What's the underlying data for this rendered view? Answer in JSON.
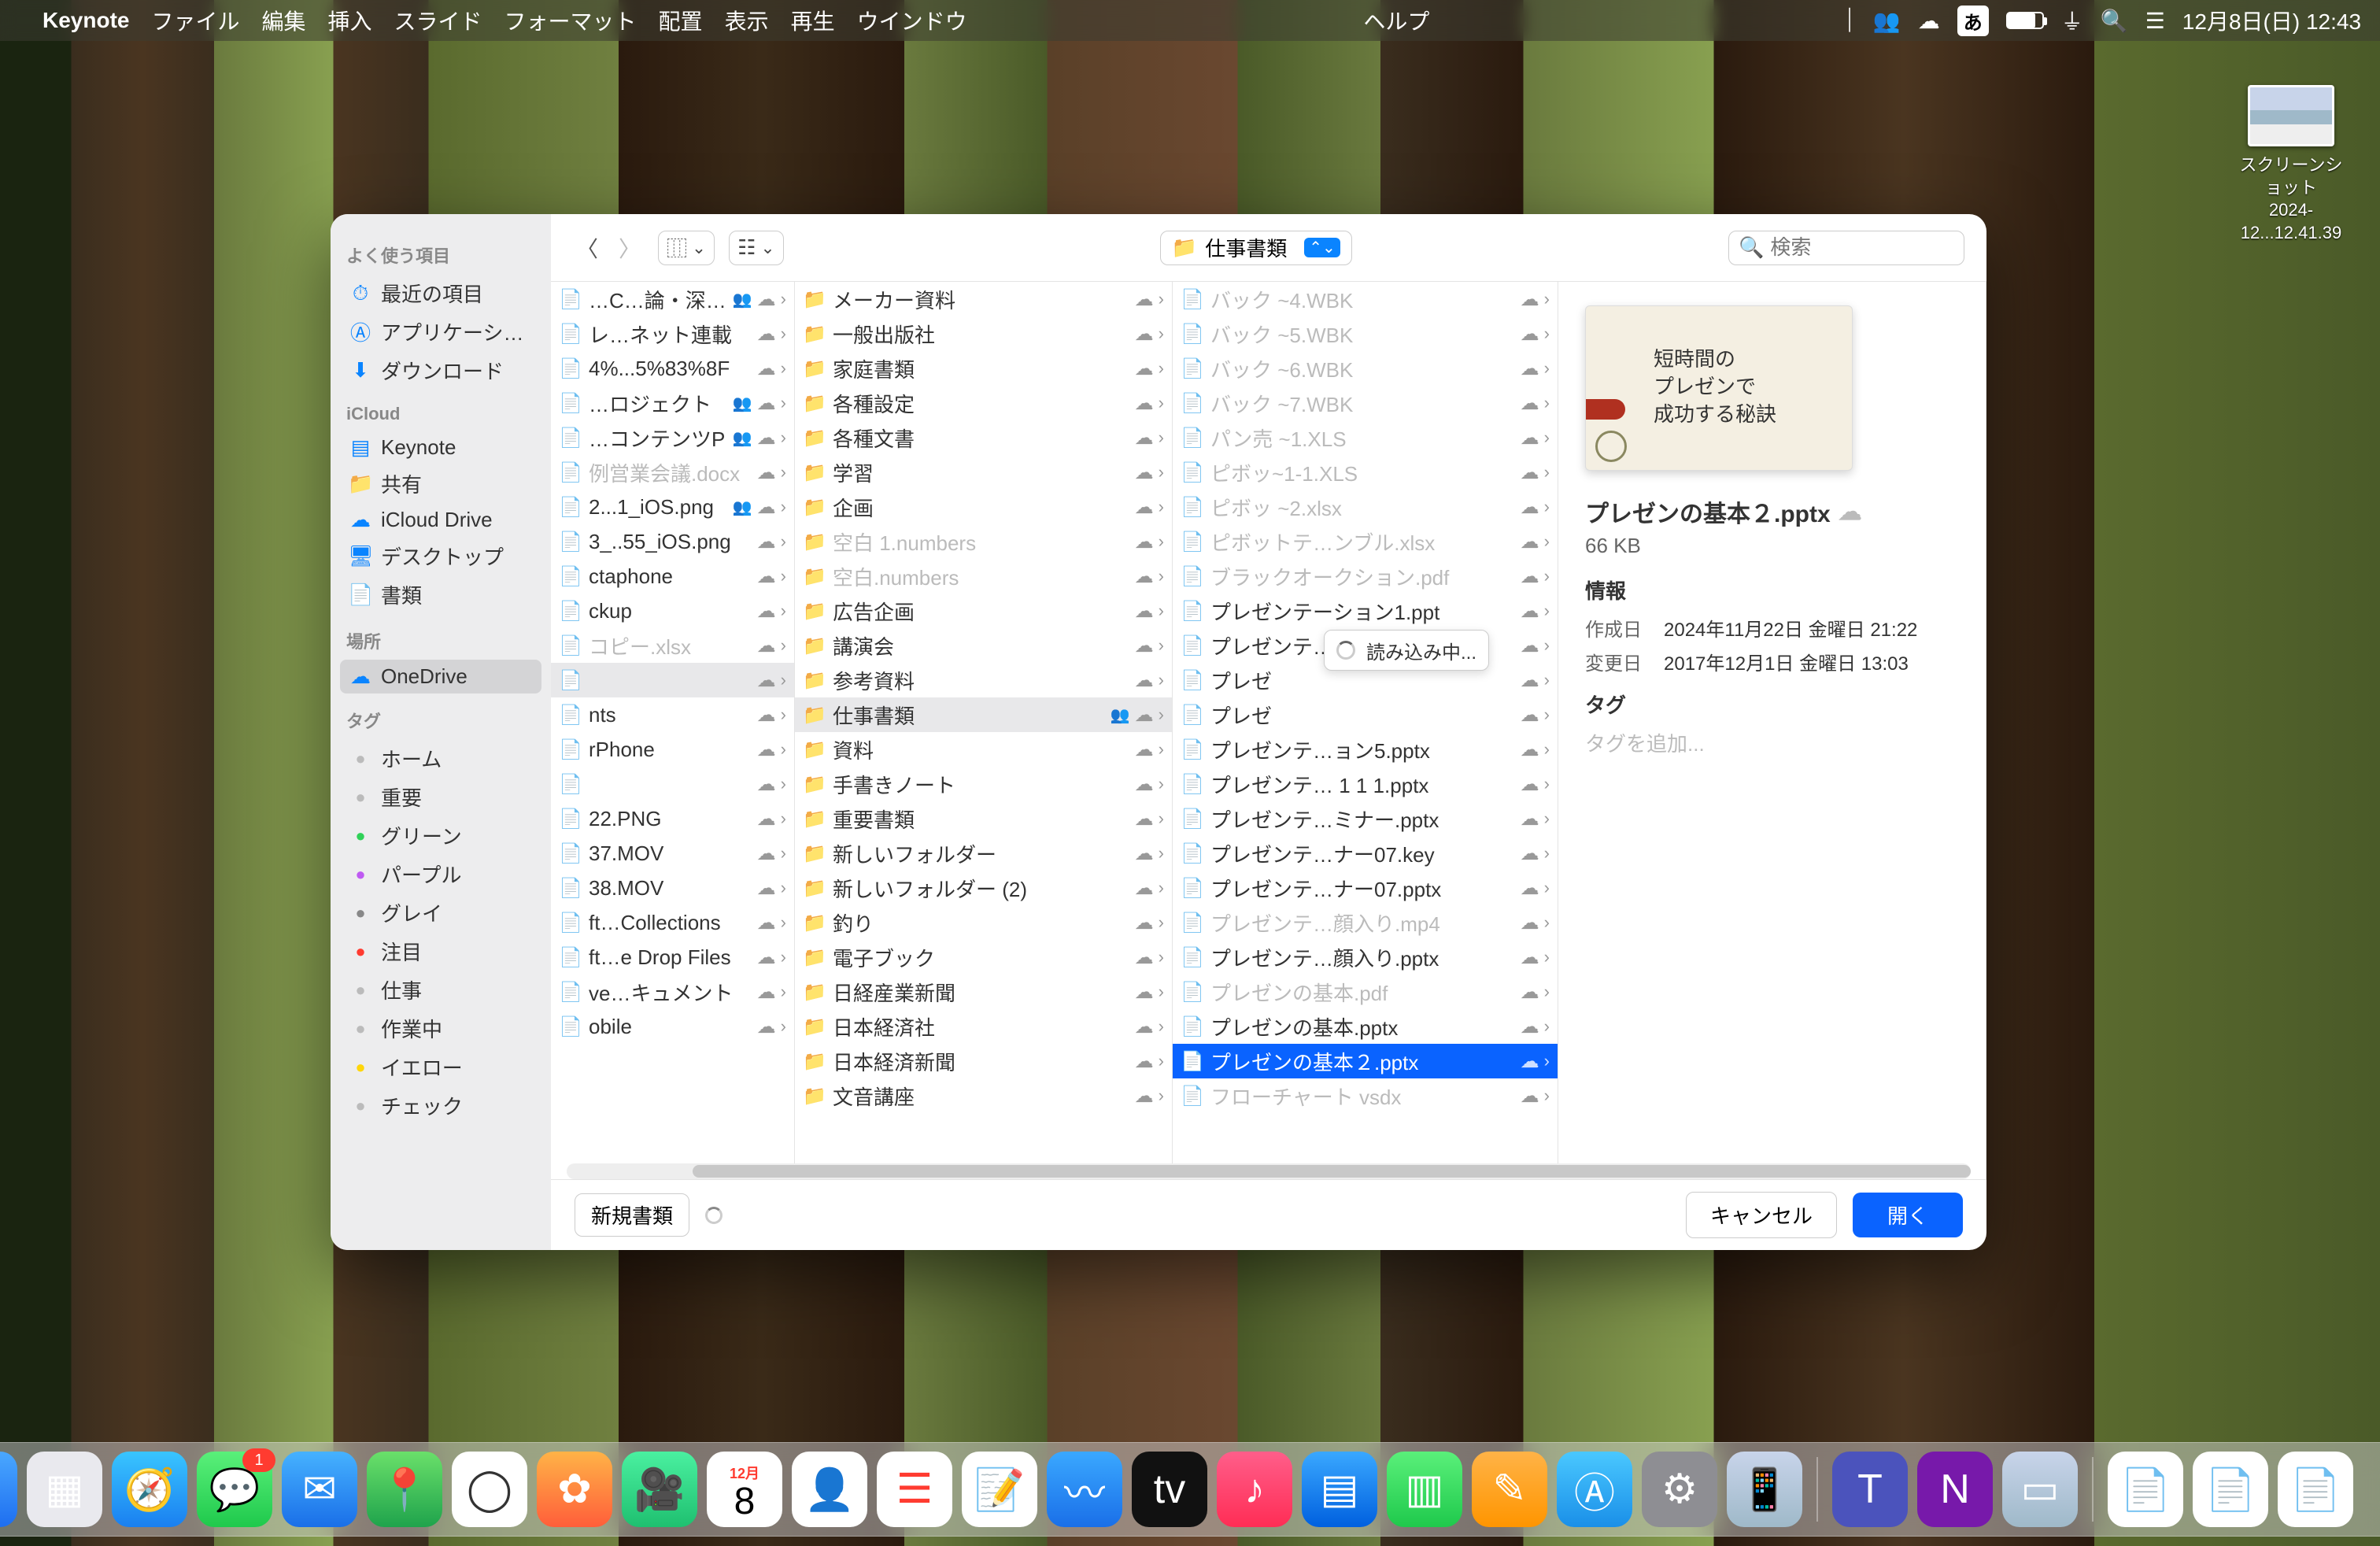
{
  "menubar": {
    "app": "Keynote",
    "items": [
      "ファイル",
      "編集",
      "挿入",
      "スライド",
      "フォーマット",
      "配置",
      "表示",
      "再生",
      "ウインドウ"
    ],
    "help": "ヘルプ",
    "ime": "あ",
    "datetime": "12月8日(日)  12:43"
  },
  "desktop_icon": {
    "line1": "スクリーンショット",
    "line2": "2024-12...12.41.39"
  },
  "dialog": {
    "path_label": "仕事書類",
    "search_placeholder": "検索",
    "loading": "読み込み中...",
    "new_doc": "新規書類",
    "cancel": "キャンセル",
    "open": "開く"
  },
  "sidebar": {
    "sec1": "よく使う項目",
    "items1": [
      {
        "icon": "⏱",
        "label": "最近の項目"
      },
      {
        "icon": "Ⓐ",
        "label": "アプリケーシ…"
      },
      {
        "icon": "⬇",
        "label": "ダウンロード"
      }
    ],
    "sec2": "iCloud",
    "items2": [
      {
        "icon": "▤",
        "label": "Keynote"
      },
      {
        "icon": "📁",
        "label": "共有"
      },
      {
        "icon": "☁",
        "label": "iCloud Drive"
      },
      {
        "icon": "🖥",
        "label": "デスクトップ"
      },
      {
        "icon": "📄",
        "label": "書類"
      }
    ],
    "sec3": "場所",
    "items3": [
      {
        "icon": "☁",
        "label": "OneDrive",
        "sel": true
      }
    ],
    "sec4": "タグ",
    "tags": [
      {
        "c": "#bbb",
        "label": "ホーム"
      },
      {
        "c": "#bbb",
        "label": "重要"
      },
      {
        "c": "#30d158",
        "label": "グリーン"
      },
      {
        "c": "#bf5af2",
        "label": "パープル"
      },
      {
        "c": "#888",
        "label": "グレイ"
      },
      {
        "c": "#ff3b30",
        "label": "注目"
      },
      {
        "c": "#bbb",
        "label": "仕事"
      },
      {
        "c": "#bbb",
        "label": "作業中"
      },
      {
        "c": "#ffd60a",
        "label": "イエロー"
      },
      {
        "c": "#bbb",
        "label": "チェック"
      }
    ]
  },
  "col0": [
    {
      "t": "…C…論・深堀り",
      "share": true
    },
    {
      "t": "レ…ネット連載"
    },
    {
      "t": "4%...5%83%8F"
    },
    {
      "t": "…ロジェクト",
      "share": true
    },
    {
      "t": "…コンテンツP",
      "share": true
    },
    {
      "t": "例営業会議.docx",
      "dim": true
    },
    {
      "t": "2...1_iOS.png",
      "share": true
    },
    {
      "t": "3_..55_iOS.png"
    },
    {
      "t": "ctaphone"
    },
    {
      "t": "ckup"
    },
    {
      "t": "コピー.xlsx",
      "dim": true
    },
    {
      "t": "",
      "sel": true
    },
    {
      "t": "nts"
    },
    {
      "t": "rPhone"
    },
    {
      "t": ""
    },
    {
      "t": "22.PNG"
    },
    {
      "t": "37.MOV"
    },
    {
      "t": "38.MOV"
    },
    {
      "t": "ft…Collections"
    },
    {
      "t": "ft…e Drop Files"
    },
    {
      "t": "ve…キュメント"
    },
    {
      "t": "obile"
    }
  ],
  "col1": [
    {
      "t": "メーカー資料"
    },
    {
      "t": "一般出版社"
    },
    {
      "t": "家庭書類"
    },
    {
      "t": "各種設定"
    },
    {
      "t": "各種文書"
    },
    {
      "t": "学習"
    },
    {
      "t": "企画"
    },
    {
      "t": "空白 1.numbers",
      "dim": true
    },
    {
      "t": "空白.numbers",
      "dim": true
    },
    {
      "t": "広告企画"
    },
    {
      "t": "講演会"
    },
    {
      "t": "参考資料"
    },
    {
      "t": "仕事書類",
      "sel": true,
      "share": true
    },
    {
      "t": "資料"
    },
    {
      "t": "手書きノート"
    },
    {
      "t": "重要書類"
    },
    {
      "t": "新しいフォルダー"
    },
    {
      "t": "新しいフォルダー (2)"
    },
    {
      "t": "釣り"
    },
    {
      "t": "電子ブック"
    },
    {
      "t": "日経産業新聞"
    },
    {
      "t": "日本経済社"
    },
    {
      "t": "日本経済新聞"
    },
    {
      "t": "文音講座"
    }
  ],
  "col2": [
    {
      "t": "バック ~4.WBK",
      "dim": true,
      "ic": "doc"
    },
    {
      "t": "バック ~5.WBK",
      "dim": true,
      "ic": "doc"
    },
    {
      "t": "バック ~6.WBK",
      "dim": true,
      "ic": "doc"
    },
    {
      "t": "バック ~7.WBK",
      "dim": true,
      "ic": "doc"
    },
    {
      "t": "パン売 ~1.XLS",
      "dim": true,
      "ic": "doc"
    },
    {
      "t": "ピボッ~1-1.XLS",
      "dim": true,
      "ic": "doc"
    },
    {
      "t": "ピボッ ~2.xlsx",
      "dim": true,
      "ic": "doc"
    },
    {
      "t": "ピボットテ…ンブル.xlsx",
      "dim": true,
      "ic": "doc"
    },
    {
      "t": "ブラックオークション.pdf",
      "dim": true,
      "ic": "pdf"
    },
    {
      "t": "プレゼンテーション1.ppt",
      "ic": "ppt"
    },
    {
      "t": "プレゼンテ…ョン1.pptx",
      "ic": "ppt"
    },
    {
      "t": "プレゼ",
      "ic": "ppt"
    },
    {
      "t": "プレゼ",
      "ic": "ppt"
    },
    {
      "t": "プレゼンテ…ョン5.pptx",
      "ic": "ppt"
    },
    {
      "t": "プレゼンテ… 1 1 1.pptx",
      "ic": "ppt"
    },
    {
      "t": "プレゼンテ…ミナー.pptx",
      "ic": "dark"
    },
    {
      "t": "プレゼンテ…ナー07.key",
      "ic": "ppt"
    },
    {
      "t": "プレゼンテ…ナー07.pptx",
      "ic": "dark"
    },
    {
      "t": "プレゼンテ…顔入り.mp4",
      "dim": true,
      "ic": "doc"
    },
    {
      "t": "プレゼンテ…顔入り.pptx",
      "ic": "dark"
    },
    {
      "t": "プレゼンの基本.pdf",
      "dim": true,
      "ic": "pdf"
    },
    {
      "t": "プレゼンの基本.pptx",
      "ic": "ppt"
    },
    {
      "t": "プレゼンの基本２.pptx",
      "ic": "ppt",
      "selblue": true
    },
    {
      "t": "フローチャート vsdx",
      "dim": true,
      "ic": "doc"
    }
  ],
  "preview": {
    "slide_l1": "短時間の",
    "slide_l2": "プレゼンで",
    "slide_l3": "成功する秘訣",
    "name": "プレゼンの基本２.pptx",
    "size": "66 KB",
    "sec_info": "情報",
    "k_created": "作成日",
    "v_created": "2024年11月22日 金曜日 21:22",
    "k_modified": "変更日",
    "v_modified": "2017年12月1日 金曜日 13:03",
    "sec_tags": "タグ",
    "tag_ph": "タグを追加..."
  },
  "dock": {
    "cal_month": "12月",
    "cal_day": "8"
  }
}
